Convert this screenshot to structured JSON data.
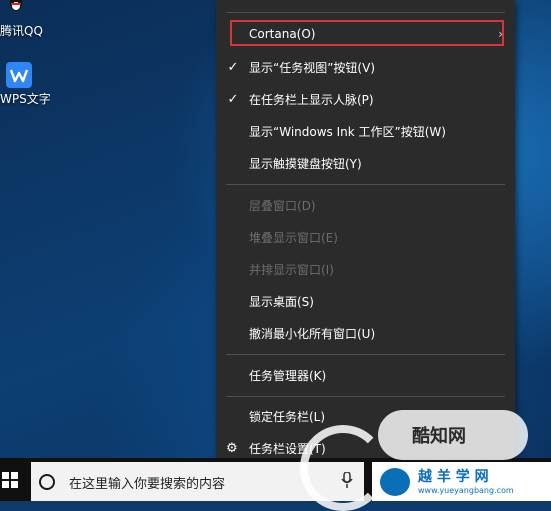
{
  "desktop": {
    "icons": [
      {
        "label": "腾讯QQ",
        "icon": "qq-icon"
      },
      {
        "label": "WPS文字",
        "icon": "wps-writer-icon"
      }
    ]
  },
  "context_menu": {
    "items": [
      {
        "label": "Cortana(O)",
        "has_submenu": true,
        "highlighted": true
      },
      {
        "label": "显示“任务视图”按钮(V)",
        "checked": true
      },
      {
        "label": "在任务栏上显示人脉(P)",
        "checked": true
      },
      {
        "label": "显示“Windows Ink 工作区”按钮(W)"
      },
      {
        "label": "显示触摸键盘按钮(Y)"
      },
      {
        "label": "层叠窗口(D)",
        "disabled": true
      },
      {
        "label": "堆叠显示窗口(E)",
        "disabled": true
      },
      {
        "label": "并排显示窗口(I)",
        "disabled": true
      },
      {
        "label": "显示桌面(S)"
      },
      {
        "label": "撤消最小化所有窗口(U)"
      },
      {
        "label": "任务管理器(K)"
      },
      {
        "label": "锁定任务栏(L)"
      },
      {
        "label": "任务栏设置(T)",
        "icon": "gear-icon"
      }
    ],
    "check_glyph": "✓",
    "submenu_glyph": "›",
    "highlight_color": "#d7343b"
  },
  "taskbar": {
    "search_placeholder": "在这里输入你要搜索的内容",
    "mic_glyph": "🎤"
  },
  "watermark": {
    "badge_text": "酷知网",
    "bar_title": "越 羊 学 网",
    "bar_url": "www.yueyangbang.com"
  }
}
